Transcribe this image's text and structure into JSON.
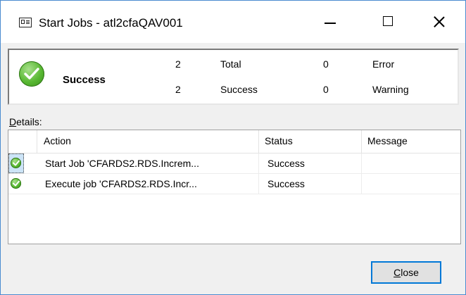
{
  "window": {
    "title": "Start Jobs - atl2cfaQAV001"
  },
  "summary": {
    "status_label": "Success",
    "total_count": "2",
    "total_label": "Total",
    "success_count": "2",
    "success_label": "Success",
    "error_count": "0",
    "error_label": "Error",
    "warning_count": "0",
    "warning_label": "Warning"
  },
  "details": {
    "label": "Details:",
    "label_mnemonic": "D",
    "label_rest": "etails:",
    "columns": [
      "Action",
      "Status",
      "Message"
    ],
    "rows": [
      {
        "action": "Start Job 'CFARDS2.RDS.Increm...",
        "status": "Success",
        "message": "",
        "selected": true
      },
      {
        "action": "Execute job 'CFARDS2.RDS.Incr...",
        "status": "Success",
        "message": "",
        "selected": false
      }
    ]
  },
  "buttons": {
    "close_mnemonic": "C",
    "close_rest": "lose"
  },
  "colors": {
    "accent": "#0078d7",
    "success_green": "#58b832",
    "selection": "#cce4f7"
  },
  "icons": {
    "window_icon": "window-icon",
    "status_icon": "success-check-icon"
  }
}
